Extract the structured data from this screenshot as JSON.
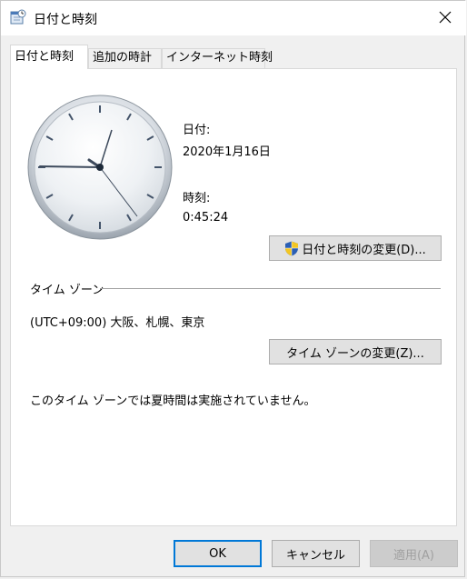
{
  "window": {
    "title": "日付と時刻"
  },
  "tabs": [
    {
      "label": "日付と時刻"
    },
    {
      "label": "追加の時計"
    },
    {
      "label": "インターネット時刻"
    }
  ],
  "datetime": {
    "date_label": "日付:",
    "date_value": "2020年1月16日",
    "time_label": "時刻:",
    "time_value": "0:45:24",
    "change_button": "日付と時刻の変更(D)..."
  },
  "timezone": {
    "heading": "タイム ゾーン",
    "value": "(UTC+09:00) 大阪、札幌、東京",
    "change_button": "タイム ゾーンの変更(Z)...",
    "dst_note": "このタイム ゾーンでは夏時間は実施されていません。"
  },
  "footer": {
    "ok": "OK",
    "cancel": "キャンセル",
    "apply": "適用(A)"
  },
  "icons": {
    "window": "calendar-clock-icon",
    "close": "close-icon",
    "uac": "uac-shield-icon",
    "clock": "analog-clock"
  }
}
